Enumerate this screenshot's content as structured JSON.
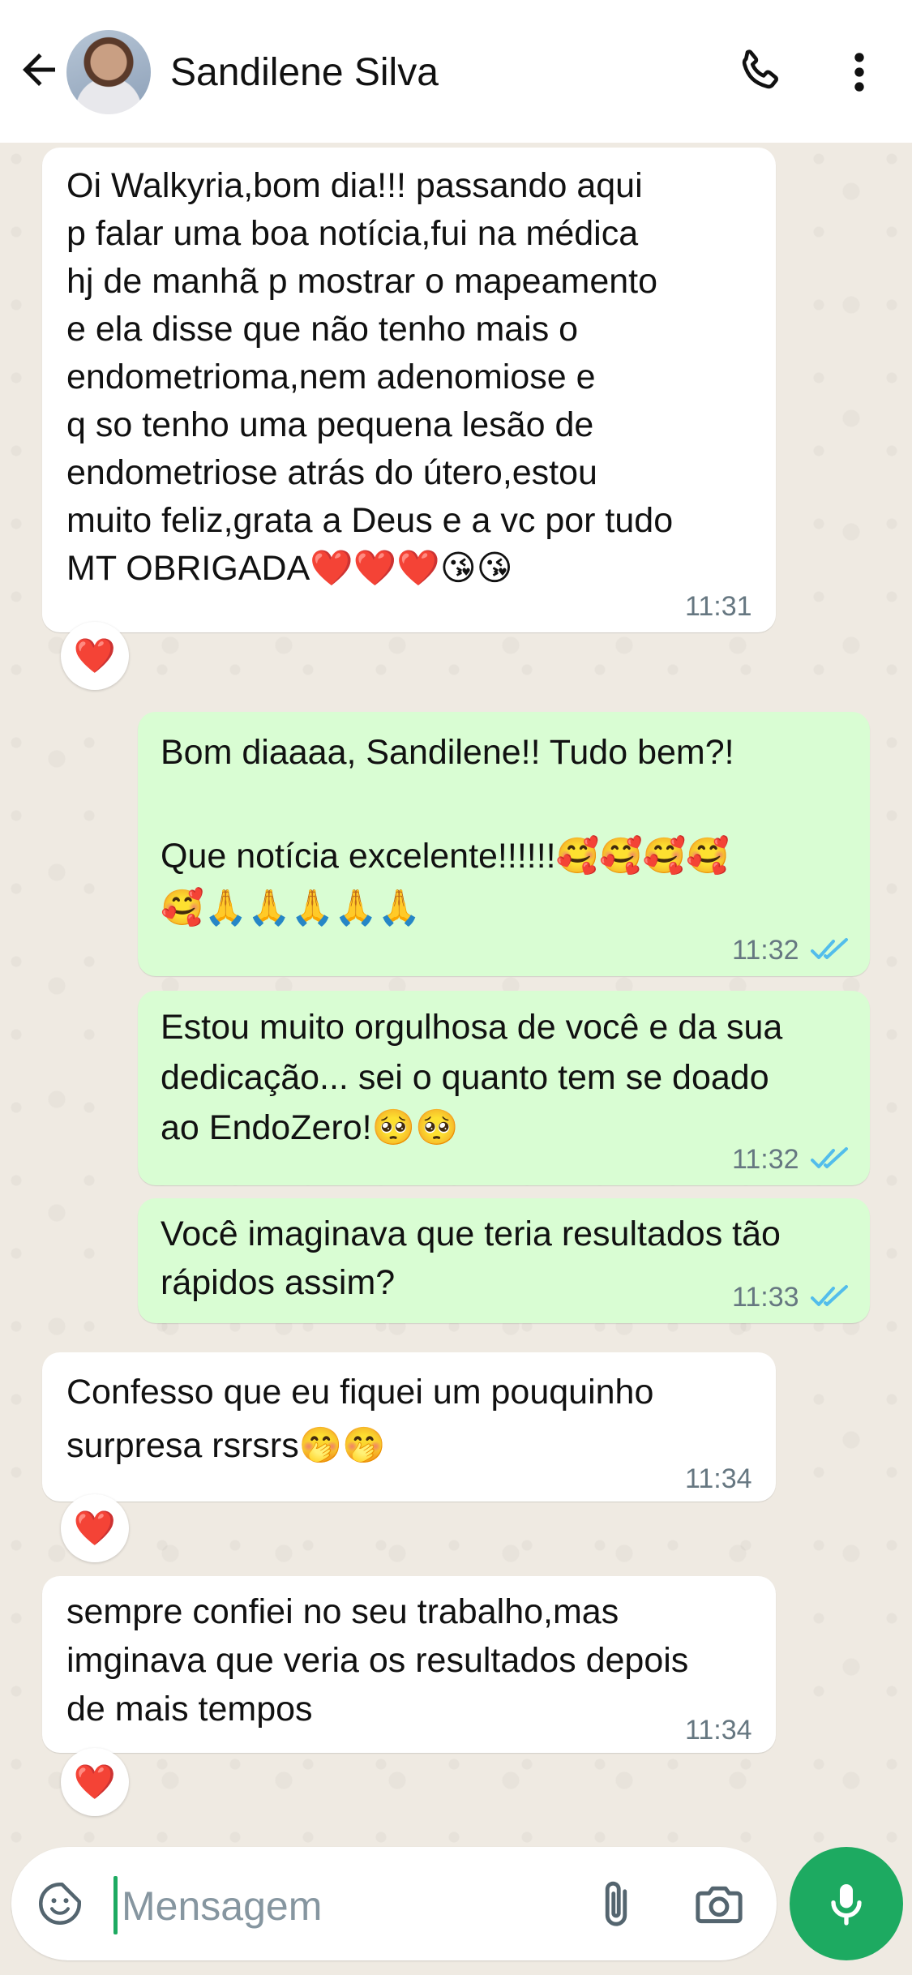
{
  "header": {
    "contact_name": "Sandilene Silva"
  },
  "messages": [
    {
      "direction": "in",
      "text": "Oi Walkyria,bom dia!!! passando aqui\np falar uma boa notícia,fui na médica\nhj de manhã p mostrar o mapeamento\ne ela disse que não tenho mais o\nendometrioma,nem adenomiose e\nq so tenho uma pequena lesão de\nendometriose atrás do útero,estou\nmuito feliz,grata a Deus e a vc por tudo\nMT OBRIGADA❤️❤️❤️😘😘",
      "time": "11:31",
      "reaction": "❤️"
    },
    {
      "direction": "out",
      "text": "Bom diaaaa, Sandilene!! Tudo bem?!\n\nQue notícia excelente!!!!!!🥰🥰🥰🥰\n🥰🙏🙏🙏🙏🙏",
      "time": "11:32"
    },
    {
      "direction": "out",
      "text": "Estou muito orgulhosa de você e da sua\ndedicação... sei o quanto tem se doado\nao EndoZero!🥺🥺",
      "time": "11:32"
    },
    {
      "direction": "out",
      "text": "Você imaginava que teria resultados tão\nrápidos assim?",
      "time": "11:33"
    },
    {
      "direction": "in",
      "text": "Confesso que eu fiquei um pouquinho\nsurpresa rsrsrs🤭🤭",
      "time": "11:34",
      "reaction": "❤️"
    },
    {
      "direction": "in",
      "text": "sempre confiei no seu trabalho,mas\nimginava que veria os resultados depois\nde mais tempos",
      "time": "11:34",
      "reaction": "❤️"
    }
  ],
  "composer": {
    "placeholder": "Mensagem"
  },
  "colors": {
    "incoming_bubble": "#ffffff",
    "outgoing_bubble": "#d9fdd3",
    "accent_green": "#1daa61",
    "read_ticks": "#53bdeb",
    "timestamp": "#667781"
  },
  "icons": {
    "back": "arrow-left-icon",
    "call": "phone-icon",
    "menu": "more-vertical-icon",
    "sticker": "sticker-smiley-icon",
    "attach": "paperclip-icon",
    "camera": "camera-icon",
    "mic": "microphone-icon",
    "read": "double-check-icon"
  }
}
